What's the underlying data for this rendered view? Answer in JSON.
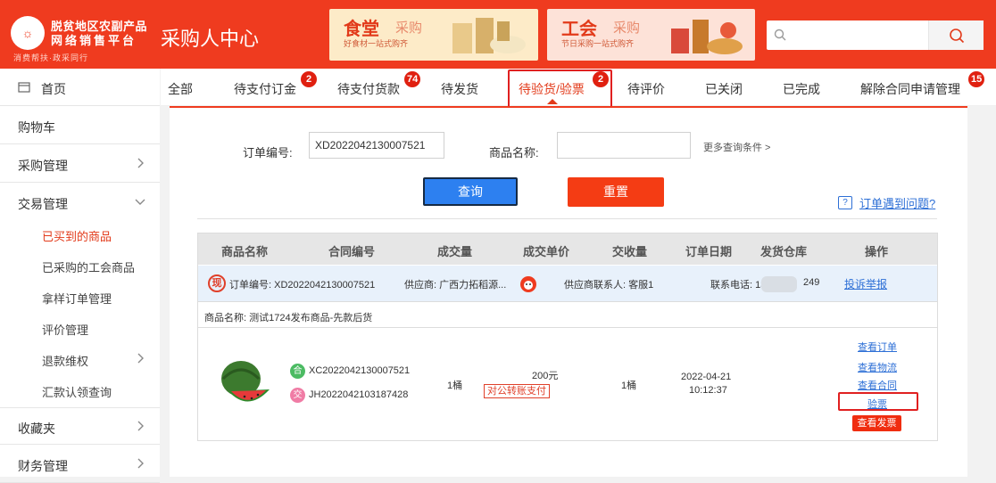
{
  "header": {
    "logo_mark": "☼",
    "logo_line1": "脱贫地区农副产品",
    "logo_line2": "网络销售平台",
    "logo_slogan": "消费帮扶·政采同行",
    "center_title": "采购人中心",
    "banner1": {
      "title": "食堂",
      "sub": "采购",
      "desc": "好食材一站式购齐"
    },
    "banner2": {
      "title": "工会",
      "sub": "采购",
      "desc": "节日采购一站式购齐"
    },
    "search_placeholder": "",
    "accent_color": "#ef3b1f"
  },
  "sidebar": {
    "home": "首页",
    "cart": "购物车",
    "purchase_mgmt": "采购管理",
    "trade_mgmt": "交易管理",
    "sub_items": [
      "已买到的商品",
      "已采购的工会商品",
      "拿样订单管理",
      "评价管理",
      "退款维权",
      "汇款认领查询"
    ],
    "favorites": "收藏夹",
    "finance": "财务管理"
  },
  "tabs": [
    {
      "label": "全部"
    },
    {
      "label": "待支付订金",
      "badge": "2"
    },
    {
      "label": "待支付货款",
      "badge": "74"
    },
    {
      "label": "待发货"
    },
    {
      "label": "待验货/验票",
      "badge": "2"
    },
    {
      "label": "待评价"
    },
    {
      "label": "已关闭"
    },
    {
      "label": "已完成"
    },
    {
      "label": "解除合同申请管理",
      "badge": "15"
    }
  ],
  "filters": {
    "order_no_label": "订单编号:",
    "order_no_value": "XD2022042130007521",
    "goods_name_label": "商品名称:",
    "goods_name_value": "",
    "more_conditions": "更多查询条件 >",
    "query_button": "查询",
    "reset_button": "重置",
    "problem_icon": "?",
    "problem_link": "订单遇到问题?"
  },
  "table": {
    "headers": [
      "商品名称",
      "合同编号",
      "成交量",
      "成交单价",
      "交收量",
      "订单日期",
      "发货仓库",
      "操作"
    ],
    "order": {
      "tag": "现",
      "order_no": "订单编号:  XD2022042130007521",
      "supplier": "供应商:  广西力拓稻源...",
      "contact": "供应商联系人:  客服1",
      "phone_prefix": "联系电话:  136",
      "phone_suffix": "249",
      "complain": "投诉举报"
    },
    "goods_name": "商品名称:  测试1724发布商品-先款后货",
    "item": {
      "contract_tag": "合",
      "contract_no": "XC2022042130007521",
      "trade_tag": "交",
      "trade_no": "JH2022042103187428",
      "quantity": "1桶",
      "price": "200元",
      "pay_method": "对公转账支付",
      "delivered": "1桶",
      "date": "2022-04-21",
      "time": "10:12:37"
    },
    "actions": {
      "view_order": "查看订单",
      "view_logistics": "查看物流",
      "view_contract": "查看合同",
      "inspect_invoice": "验票",
      "view_invoice": "查看发票"
    }
  }
}
